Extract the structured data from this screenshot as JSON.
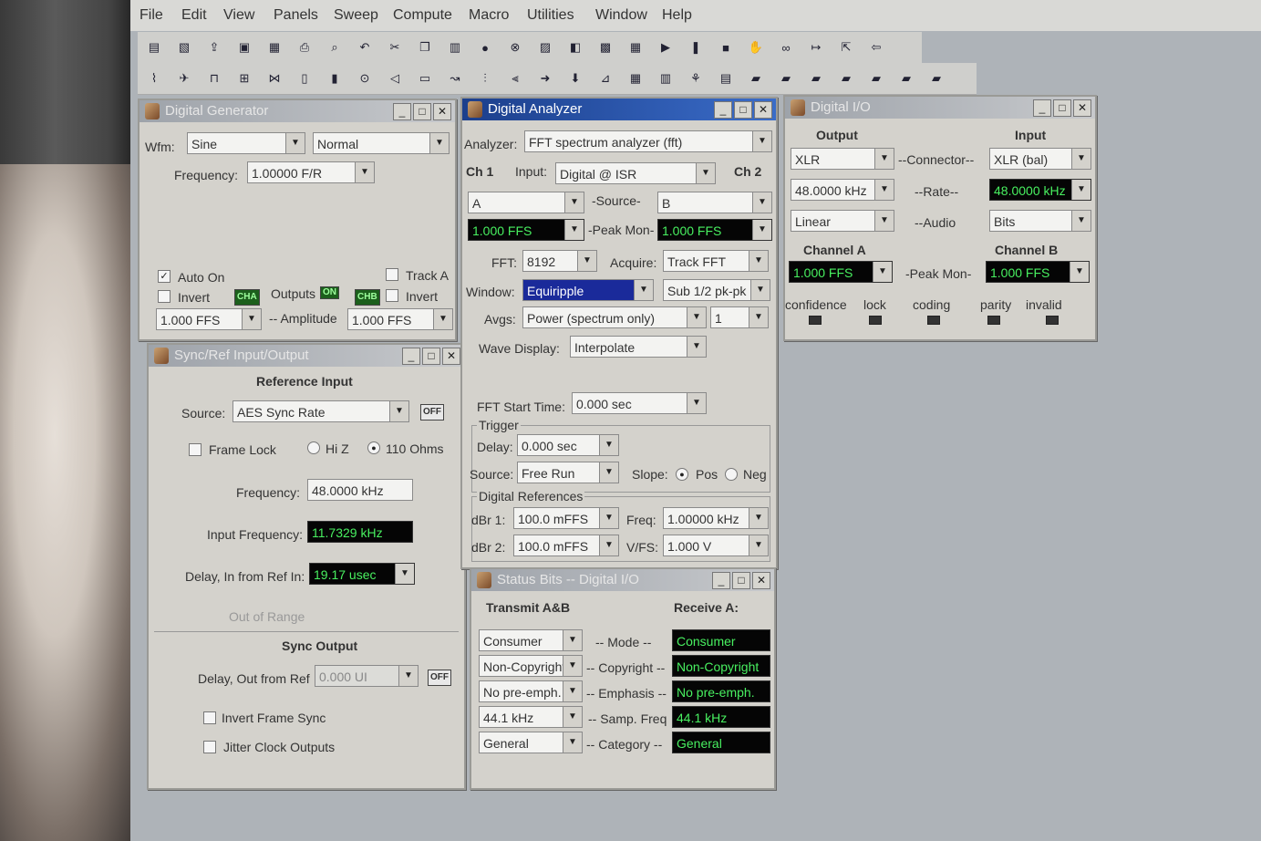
{
  "menu": [
    "File",
    "Edit",
    "View",
    "Panels",
    "Sweep",
    "Compute",
    "Macro",
    "Utilities",
    "Window",
    "Help"
  ],
  "toolbar1_icons": [
    "new-icon",
    "open-icon",
    "import-icon",
    "save-icon",
    "save-all-icon",
    "print-icon",
    "print-preview-icon",
    "undo-icon",
    "cut-icon",
    "copy-icon",
    "paste-icon",
    "go-icon",
    "stop-icon",
    "graph-icon",
    "tools-icon",
    "panel-icon",
    "macro-icon",
    "play-icon",
    "pause-icon",
    "stop-square-icon",
    "hand-icon",
    "binoculars-icon",
    "step-icon",
    "export-icon",
    "back-icon"
  ],
  "toolbar2_icons": [
    "graph-panel-icon",
    "sweep-icon",
    "meter-icon",
    "analyzer-icon",
    "waveform-icon",
    "filter-icon",
    "bars-icon",
    "clock-icon",
    "speaker-icon",
    "dcx-icon",
    "wave-icon",
    "level-icon",
    "bal-icon",
    "arrow-right-icon",
    "arrow-down-icon",
    "chart-icon",
    "table-icon",
    "bargraph-icon",
    "tree-icon",
    "notes-icon",
    "scope1-icon",
    "scope2-icon",
    "scope3-icon",
    "scope4-icon",
    "scope5-icon",
    "scope6-icon",
    "scope7-icon"
  ],
  "gen": {
    "title": "Digital Generator",
    "wfm_label": "Wfm:",
    "wfm": "Sine",
    "wfm2": "Normal",
    "freq_label": "Frequency:",
    "freq": "1.00000 F/R",
    "auto_on": "Auto On",
    "track_a": "Track A",
    "invert": "Invert",
    "invert2": "Invert",
    "cha": "CHA",
    "outputs": "Outputs",
    "outputs_state": "ON",
    "chb": "CHB",
    "amp_left": "1.000    FFS",
    "amp_label": "-- Amplitude",
    "amp_right": "1.000    FFS"
  },
  "sync": {
    "title": "Sync/Ref Input/Output",
    "ref_input": "Reference Input",
    "source_label": "Source:",
    "source": "AES Sync Rate",
    "off": "OFF",
    "frame_lock": "Frame Lock",
    "hiz": "Hi Z",
    "ohms": "110 Ohms",
    "freq_label": "Frequency:",
    "freq": "48.0000 kHz",
    "infreq_label": "Input Frequency:",
    "infreq": "11.7329 kHz",
    "delay_label": "Delay, In from Ref In:",
    "delay": "19.17    usec",
    "out_of_range": "Out of Range",
    "sync_output": "Sync Output",
    "delay_out_label": "Delay, Out from Ref",
    "delay_out": "0.000    UI",
    "off2": "OFF",
    "invert_frame": "Invert Frame Sync",
    "jitter": "Jitter Clock Outputs"
  },
  "analyzer": {
    "title": "Digital Analyzer",
    "analyzer_label": "Analyzer:",
    "analyzer": "FFT spectrum analyzer (fft)",
    "ch1": "Ch 1",
    "input_label": "Input:",
    "input": "Digital @ ISR",
    "ch2": "Ch 2",
    "src_a": "A",
    "source_label": "-Source-",
    "src_b": "B",
    "peak_a": "1.000    FFS",
    "peak_label": "-Peak Mon-",
    "peak_b": "1.000    FFS",
    "fft_label": "FFT:",
    "fft": "8192",
    "acquire_label": "Acquire:",
    "acquire": "Track FFT",
    "window_label": "Window:",
    "window": "Equiripple",
    "window2": "Sub 1/2 pk-pk",
    "avgs_label": "Avgs:",
    "avgs": "Power (spectrum only)",
    "avgs_n": "1",
    "wave_label": "Wave Display:",
    "wave": "Interpolate",
    "start_label": "FFT Start Time:",
    "start": "0.000    sec",
    "trigger": "Trigger",
    "delay_label": "Delay:",
    "delay": "0.000    sec",
    "tsource_label": "Source:",
    "tsource": "Free Run",
    "slope_label": "Slope:",
    "pos": "Pos",
    "neg": "Neg",
    "dref": "Digital References",
    "dbr1_label": "dBr 1:",
    "dbr1": "100.0   mFFS",
    "freq_label": "Freq:",
    "freq": "1.00000 kHz",
    "dbr2_label": "dBr 2:",
    "dbr2": "100.0   mFFS",
    "vfs_label": "V/FS:",
    "vfs": "1.000     V"
  },
  "status": {
    "title": "Status Bits -- Digital I/O",
    "transmit": "Transmit A&B",
    "receive": "Receive A:",
    "rows": [
      {
        "tx": "Consumer",
        "label": "-- Mode --",
        "rx": "Consumer"
      },
      {
        "tx": "Non-Copyright",
        "label": "-- Copyright --",
        "rx": "Non-Copyright"
      },
      {
        "tx": "No pre-emph.",
        "label": "-- Emphasis --",
        "rx": "No pre-emph."
      },
      {
        "tx": "44.1 kHz",
        "label": "-- Samp. Freq",
        "rx": "44.1 kHz"
      },
      {
        "tx": "General",
        "label": "-- Category --",
        "rx": "General"
      }
    ]
  },
  "dio": {
    "title": "Digital I/O",
    "output": "Output",
    "input": "Input",
    "conn_out": "XLR",
    "conn_label": "--Connector--",
    "conn_in": "XLR (bal)",
    "rate_out": "48.0000 kHz",
    "rate_label": "--Rate--",
    "rate_in": "48.0000 kHz",
    "audio_out": "Linear",
    "audio_label": "--Audio",
    "audio_in": "Bits",
    "cha": "Channel A",
    "chb": "Channel B",
    "peak_a": "1.000    FFS",
    "peak_label": "-Peak Mon-",
    "peak_b": "1.000    FFS",
    "indicators": [
      "confidence",
      "lock",
      "coding",
      "parity",
      "invalid"
    ]
  }
}
